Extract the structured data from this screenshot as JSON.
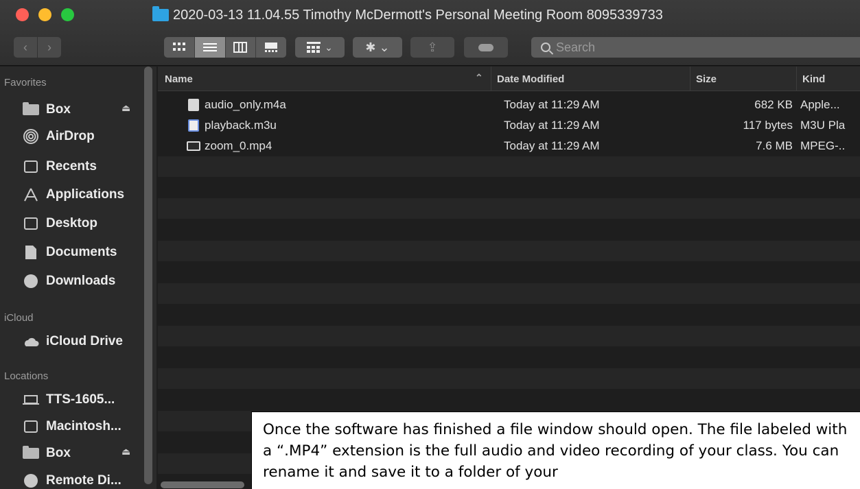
{
  "window": {
    "title": "2020-03-13 11.04.55 Timothy McDermott's Personal Meeting Room 8095339733"
  },
  "toolbar": {
    "back_glyph": "‹",
    "forward_glyph": "›",
    "view_icons": [
      "icon-view-icon",
      "list-view-icon",
      "column-view-icon",
      "gallery-view-icon"
    ],
    "group_glyph": "⌄",
    "action_glyph": "✱ ⌄",
    "share_glyph": "⇪",
    "search_placeholder": "Search"
  },
  "sidebar": {
    "sections": {
      "favorites": "Favorites",
      "icloud": "iCloud",
      "locations": "Locations"
    },
    "favorites": [
      {
        "label": "Box",
        "icon": "folder-icon"
      },
      {
        "label": "AirDrop",
        "icon": "airdrop-icon"
      },
      {
        "label": "Recents",
        "icon": "recents-icon"
      },
      {
        "label": "Applications",
        "icon": "applications-icon"
      },
      {
        "label": "Desktop",
        "icon": "desktop-icon"
      },
      {
        "label": "Documents",
        "icon": "documents-icon"
      },
      {
        "label": "Downloads",
        "icon": "downloads-icon"
      }
    ],
    "icloud": [
      {
        "label": "iCloud Drive",
        "icon": "cloud-icon"
      }
    ],
    "locations": [
      {
        "label": "TTS-1605...",
        "icon": "laptop-icon"
      },
      {
        "label": "Macintosh...",
        "icon": "disk-icon"
      },
      {
        "label": "Box",
        "icon": "folder-icon"
      },
      {
        "label": "Remote Di...",
        "icon": "remote-disc-icon"
      }
    ]
  },
  "columns": {
    "name": "Name",
    "date": "Date Modified",
    "size": "Size",
    "kind": "Kind"
  },
  "files": [
    {
      "name": "audio_only.m4a",
      "date": "Today at 11:29 AM",
      "size": "682 KB",
      "kind": "Apple...",
      "icon": "audio-file-icon"
    },
    {
      "name": "playback.m3u",
      "date": "Today at 11:29 AM",
      "size": "117 bytes",
      "kind": "M3U Pla",
      "icon": "playlist-file-icon"
    },
    {
      "name": "zoom_0.mp4",
      "date": "Today at 11:29 AM",
      "size": "7.6 MB",
      "kind": "MPEG-..",
      "icon": "video-file-icon"
    }
  ],
  "caption": {
    "text": "Once the software has finished a file window should open. The file labeled with a “.MP4” extension is the full audio and video recording of your class. You can rename it and save it to a folder of your"
  },
  "colors": {
    "folder_accent": "#2ea3e3",
    "close": "#ff5f57",
    "minimize": "#febc2e",
    "maximize": "#28c840"
  }
}
